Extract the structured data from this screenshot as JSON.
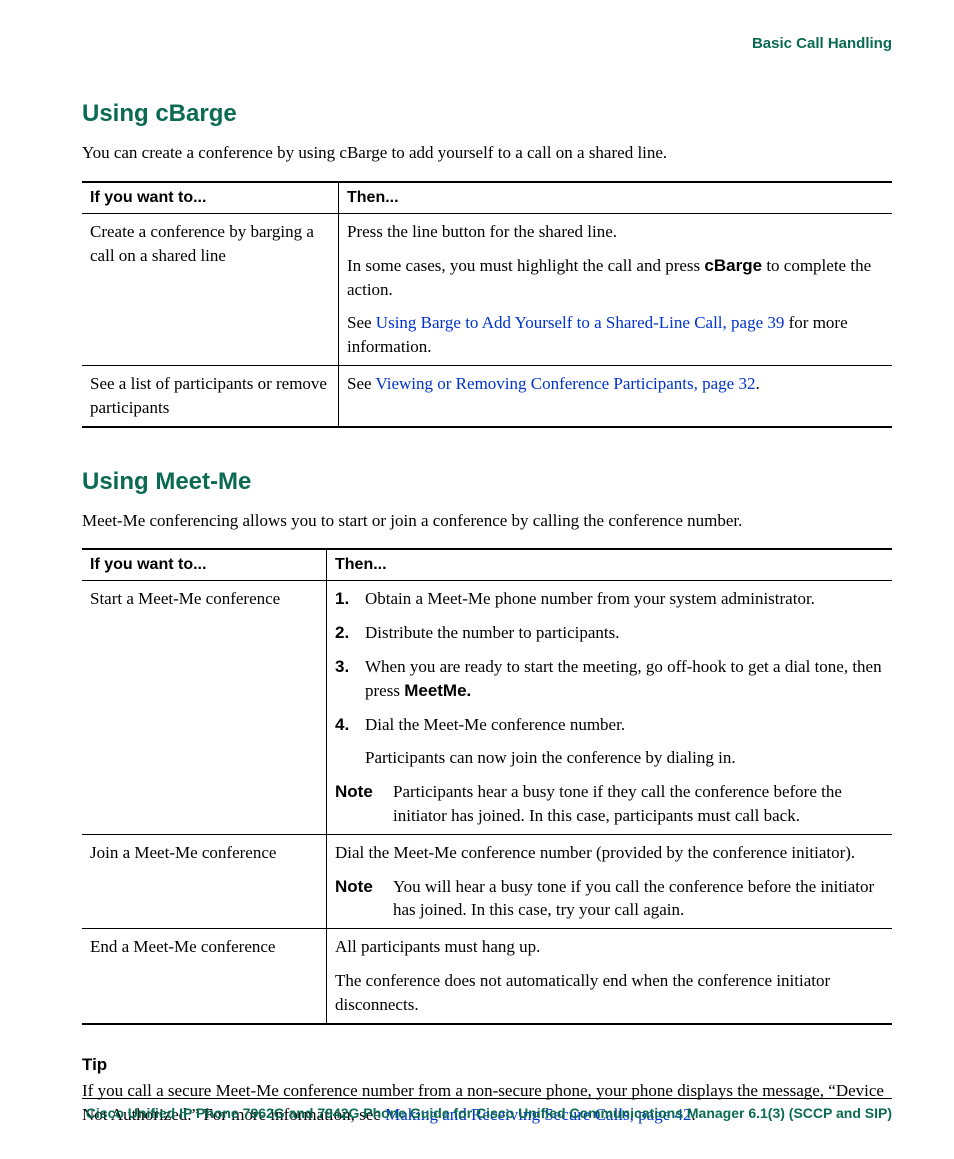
{
  "header": "Basic Call Handling",
  "section1": {
    "title": "Using cBarge",
    "intro": "You can create a conference by using cBarge to add yourself to a call on a shared line.",
    "th1": "If you want to...",
    "th2": "Then...",
    "row1_left": "Create a conference by barging a call on a shared line",
    "row1_p1": "Press the line button for the shared line.",
    "row1_p2a": "In some cases, you must highlight the call and press ",
    "row1_p2b": "cBarge",
    "row1_p2c": " to complete the action.",
    "row1_p3a": "See ",
    "row1_link1": "Using Barge to Add Yourself to a Shared-Line Call, page 39",
    "row1_p3b": " for more information.",
    "row2_left": "See a list of participants or remove participants",
    "row2_a": "See ",
    "row2_link": "Viewing or Removing Conference Participants, page 32",
    "row2_b": "."
  },
  "section2": {
    "title": "Using Meet-Me",
    "intro": "Meet-Me conferencing allows you to start or join a conference by calling the conference number.",
    "th1": "If you want to...",
    "th2": "Then...",
    "row1_left": "Start a Meet-Me conference",
    "step1_num": "1.",
    "step1_txt": "Obtain a Meet-Me phone number from your system administrator.",
    "step2_num": "2.",
    "step2_txt": "Distribute the number to participants.",
    "step3_num": "3.",
    "step3_a": "When you are ready to start the meeting, go off-hook to get a dial tone, then press ",
    "step3_b": "MeetMe.",
    "step4_num": "4.",
    "step4_txt": "Dial the Meet-Me conference number.",
    "after_steps": "Participants can now join the conference by dialing in.",
    "note_lbl": "Note",
    "note1_txt": "Participants hear a busy tone if they call the conference before the initiator has joined. In this case, participants must call back.",
    "row2_left": "Join a Meet-Me conference",
    "row2_p1": "Dial the Meet-Me conference number (provided by the conference initiator).",
    "note2_txt": "You will hear a busy tone if you call the conference before the initiator has joined. In this case, try your call again.",
    "row3_left": "End a Meet-Me conference",
    "row3_p1": "All participants must hang up.",
    "row3_p2": "The conference does not automatically end when the conference initiator disconnects."
  },
  "tip": {
    "heading": "Tip",
    "body_a": "If you call a secure Meet-Me conference number from a non-secure phone, your phone displays the message, “Device Not Authorized.” For more information, see ",
    "link": "Making and Receiving Secure Calls, page 42",
    "body_b": "."
  },
  "footer": "Cisco Unified IP Phone 7962G and 7942G Phone Guide for Cisco Unified Communications Manager 6.1(3) (SCCP and SIP)"
}
